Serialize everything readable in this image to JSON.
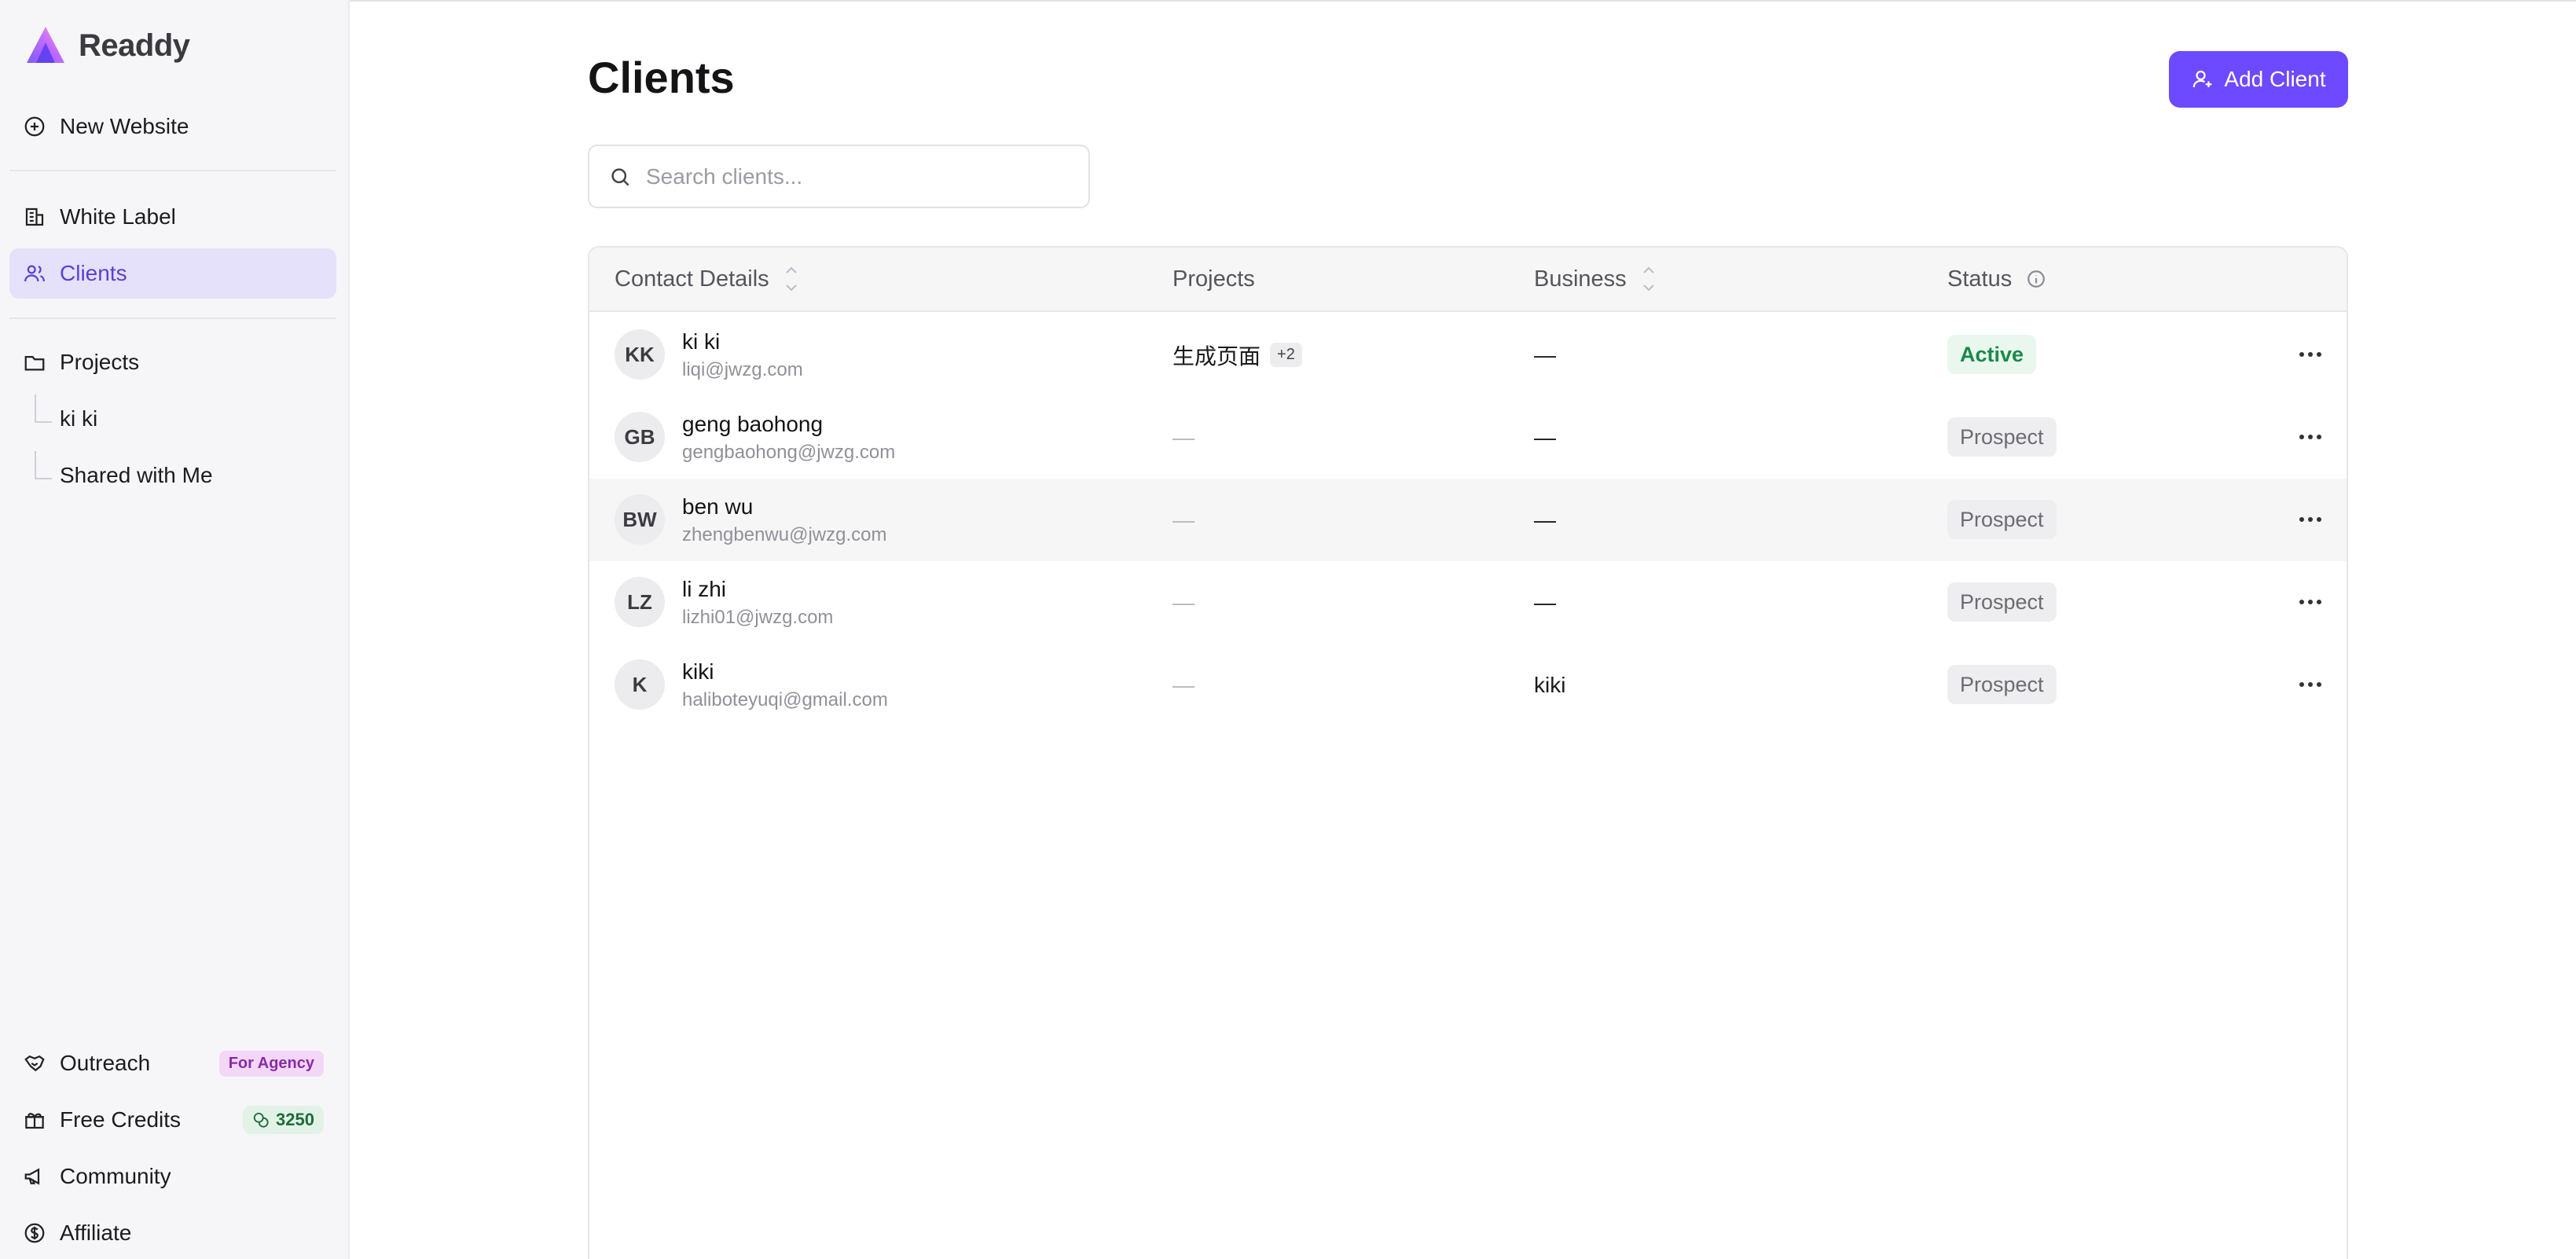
{
  "app": {
    "name": "Readdy"
  },
  "sidebar": {
    "new_website": "New Website",
    "white_label": "White Label",
    "clients": "Clients",
    "projects": "Projects",
    "project_items": [
      "ki ki",
      "Shared with Me"
    ],
    "outreach": "Outreach",
    "outreach_badge": "For Agency",
    "free_credits": "Free Credits",
    "credits_value": "3250",
    "community": "Community",
    "affiliate": "Affiliate"
  },
  "page": {
    "title": "Clients",
    "add_button": "Add Client",
    "search_placeholder": "Search clients..."
  },
  "table": {
    "headers": {
      "contact": "Contact Details",
      "projects": "Projects",
      "business": "Business",
      "status": "Status"
    },
    "rows": [
      {
        "initials": "KK",
        "name": "ki ki",
        "email": "liqi@jwzg.com",
        "project": "生成页面",
        "project_more": "+2",
        "business": "—",
        "status": "Active"
      },
      {
        "initials": "GB",
        "name": "geng baohong",
        "email": "gengbaohong@jwzg.com",
        "project": "—",
        "project_more": "",
        "business": "—",
        "status": "Prospect"
      },
      {
        "initials": "BW",
        "name": "ben wu",
        "email": "zhengbenwu@jwzg.com",
        "project": "—",
        "project_more": "",
        "business": "—",
        "status": "Prospect"
      },
      {
        "initials": "LZ",
        "name": "li zhi",
        "email": "lizhi01@jwzg.com",
        "project": "—",
        "project_more": "",
        "business": "—",
        "status": "Prospect"
      },
      {
        "initials": "K",
        "name": "kiki",
        "email": "haliboteyuqi@gmail.com",
        "project": "—",
        "project_more": "",
        "business": "kiki",
        "status": "Prospect"
      }
    ]
  },
  "colors": {
    "accent": "#6d4aff",
    "active_nav_bg": "#e5e1fb",
    "status_active": "#1a8a4a",
    "status_prospect": "#6b6b72"
  }
}
